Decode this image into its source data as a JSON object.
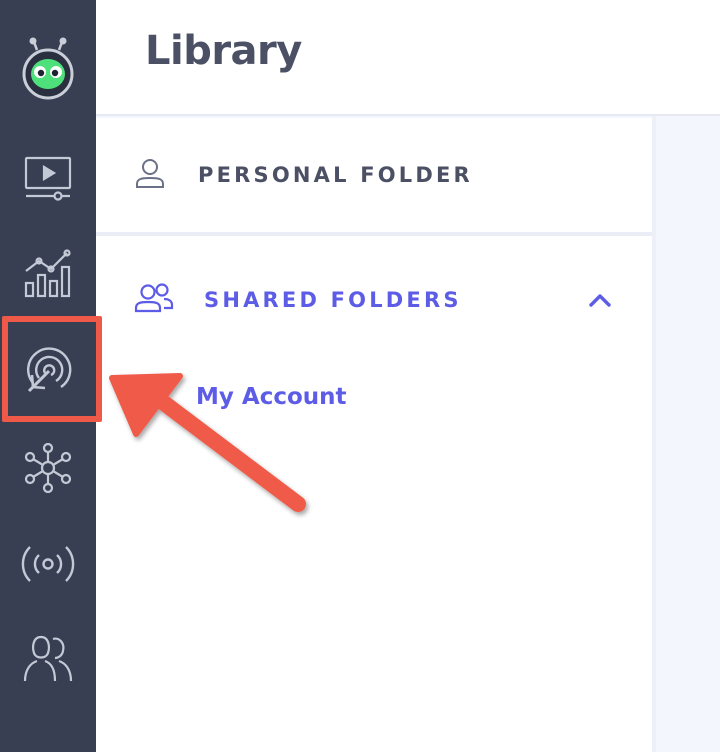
{
  "header": {
    "title": "Library"
  },
  "folders": {
    "personal": {
      "label": "PERSONAL FOLDER",
      "icon": "user-icon"
    },
    "shared": {
      "label": "SHARED FOLDERS",
      "icon": "users-icon",
      "expanded": true,
      "items": [
        {
          "label": "My Account"
        }
      ]
    }
  },
  "sidebar": {
    "items": [
      {
        "name": "logo",
        "icon": "robot-logo-icon"
      },
      {
        "name": "videos",
        "icon": "video-player-icon"
      },
      {
        "name": "analytics",
        "icon": "analytics-chart-icon"
      },
      {
        "name": "targeting",
        "icon": "target-cursor-icon",
        "highlighted": true
      },
      {
        "name": "network",
        "icon": "network-nodes-icon"
      },
      {
        "name": "broadcast",
        "icon": "broadcast-icon"
      },
      {
        "name": "team",
        "icon": "team-users-icon"
      }
    ]
  },
  "colors": {
    "sidebar_bg": "#383f53",
    "accent": "#5d5ce6",
    "annotation": "#ef5a48",
    "text_dark": "#4b5064",
    "logo_green": "#4ee07a"
  }
}
